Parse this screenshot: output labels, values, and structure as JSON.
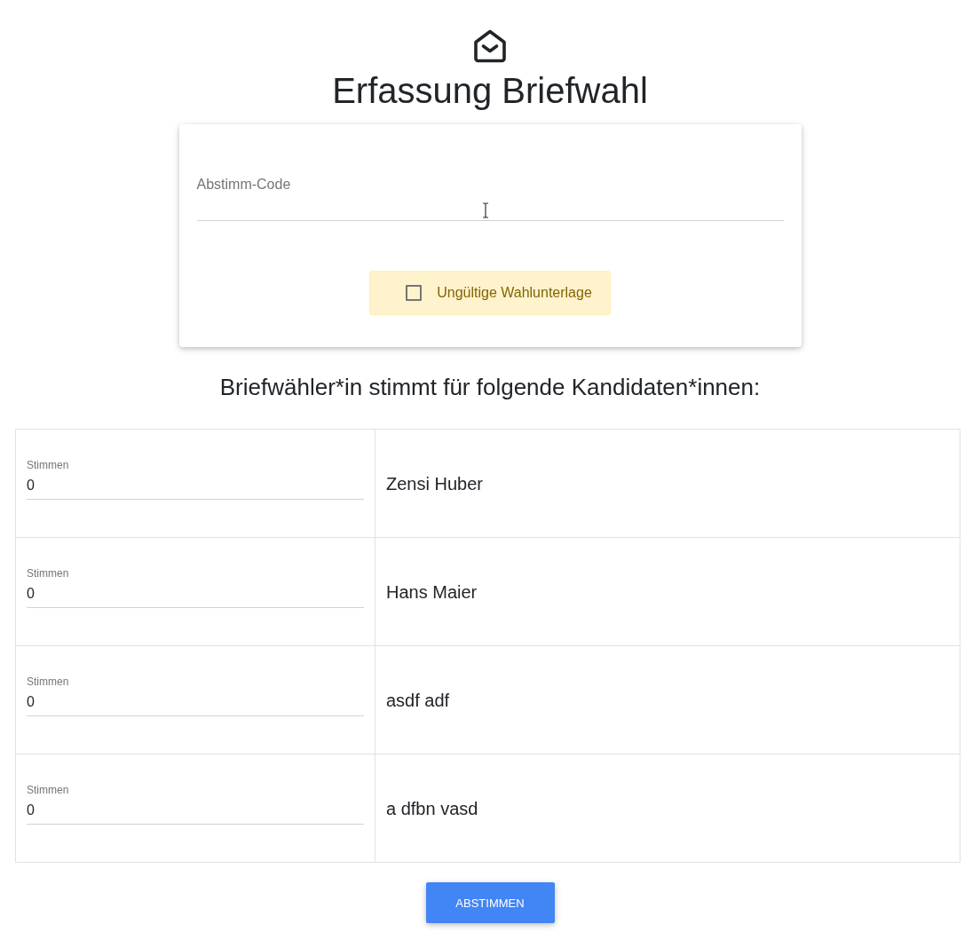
{
  "header": {
    "title": "Erfassung Briefwahl"
  },
  "code_field": {
    "label": "Abstimm-Code"
  },
  "invalid_ballot": {
    "label": "Ungültige Wahlunterlage",
    "checked": false
  },
  "candidates_heading": "Briefwähler*in stimmt für folgende Kandidaten*innen:",
  "candidates": [
    {
      "votes_label": "Stimmen",
      "votes": "0",
      "name": "Zensi Huber"
    },
    {
      "votes_label": "Stimmen",
      "votes": "0",
      "name": "Hans Maier"
    },
    {
      "votes_label": "Stimmen",
      "votes": "0",
      "name": "asdf adf"
    },
    {
      "votes_label": "Stimmen",
      "votes": "0",
      "name": "a dfbn vasd"
    }
  ],
  "submit_button": "ABSTIMMEN"
}
